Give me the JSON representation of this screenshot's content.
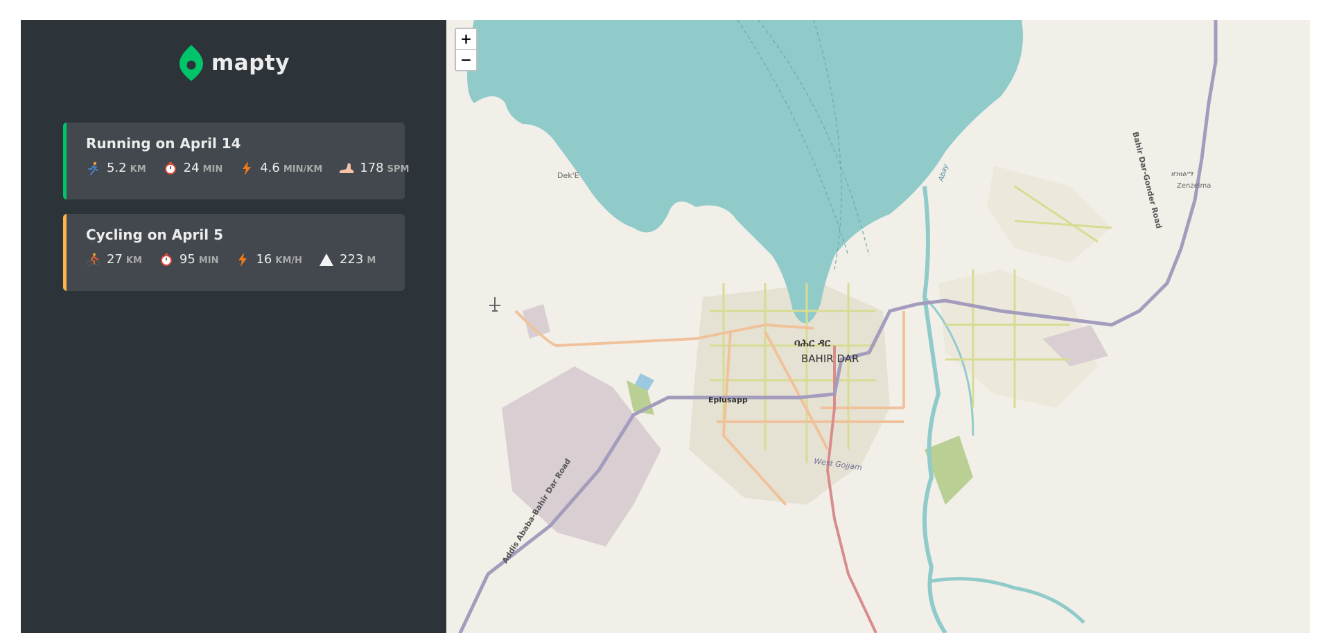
{
  "logo": {
    "text": "mapty"
  },
  "workouts": [
    {
      "type": "running",
      "title": "Running on April 14",
      "details": [
        {
          "icon": "runner-icon",
          "value": "5.2",
          "unit": "km"
        },
        {
          "icon": "stopwatch-icon",
          "value": "24",
          "unit": "min"
        },
        {
          "icon": "lightning-icon",
          "value": "4.6",
          "unit": "min/km"
        },
        {
          "icon": "foot-icon",
          "value": "178",
          "unit": "spm"
        }
      ]
    },
    {
      "type": "cycling",
      "title": "Cycling on April 5",
      "details": [
        {
          "icon": "cyclist-icon",
          "value": "27",
          "unit": "km"
        },
        {
          "icon": "stopwatch-icon",
          "value": "95",
          "unit": "min"
        },
        {
          "icon": "lightning-icon",
          "value": "16",
          "unit": "km/h"
        },
        {
          "icon": "mountain-icon",
          "value": "223",
          "unit": "m"
        }
      ]
    }
  ],
  "map": {
    "zoom_in": "+",
    "zoom_out": "−",
    "labels": {
      "city_amharic": "ባሕር ዳር",
      "city": "BAHIR DAR",
      "eplusapp": "Eplusapp",
      "dek_e": "Dek'E",
      "zenzelma_amharic": "ዘንዘልማ",
      "zenzelma": "Zenzelma",
      "west_gojjam": "West Gojjam",
      "abay": "Abay",
      "gonder_road": "Bahir Dar-Gonder Road",
      "addis_road": "Addis Ababa-Bahir Dar Road"
    },
    "colors": {
      "water": "#90cbca",
      "land": "#f2efe9",
      "residential": "#e0dfdf",
      "trunk_road": "#a39cbd",
      "primary_road": "#d98c8c",
      "secondary_road": "#f0c29c",
      "tertiary_road": "#d7dc93"
    }
  }
}
